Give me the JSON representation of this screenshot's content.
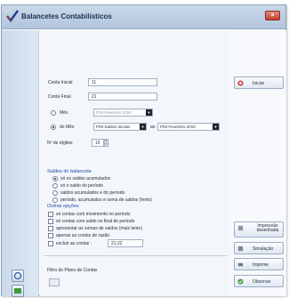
{
  "window": {
    "title": "Balancetes Contabilísticos",
    "close_label": "×"
  },
  "form": {
    "conta_inicial": {
      "label": "Conta Inicial",
      "value": "11"
    },
    "conta_final": {
      "label": "Conta Final",
      "value": "21"
    },
    "mes": {
      "label": "Mês",
      "value": "P02-Fevereiro 2010"
    },
    "do_mes": {
      "label": "do Mês",
      "from_value": "P00-Saldos Iniciais",
      "connector": "ao",
      "to_value": "P02-Fevereiro 2010"
    },
    "digitos": {
      "label": "Nº de dígitos",
      "value": "15"
    }
  },
  "saldos": {
    "title": "Saldos do balancete",
    "options": [
      "só os saldos acumulados",
      "só o saldo do período",
      "saldos acumulados e do período",
      "período, acumulados e soma de saldos (lento)"
    ]
  },
  "outras": {
    "title": "Outras opções",
    "options": [
      "só contas com movimento no período",
      "só contas com saldo no final do período",
      "apresentar as somas de saldos (mais lento)",
      "apenas as contas de razão",
      "excluir as contas :"
    ],
    "excluir_value": "21;22"
  },
  "filtro": {
    "label": "Filtro do Plano de Contas",
    "value": ""
  },
  "buttons": {
    "initiate": "Iniciar",
    "impressao": "Impressão desenhada",
    "simulacao": "Simulação",
    "imprime": "Imprime",
    "observar": "Observar"
  },
  "colors": {
    "titlebar": "#b2c5dc",
    "accent": "#1b4fa3",
    "panel": "#f3f6fa"
  }
}
